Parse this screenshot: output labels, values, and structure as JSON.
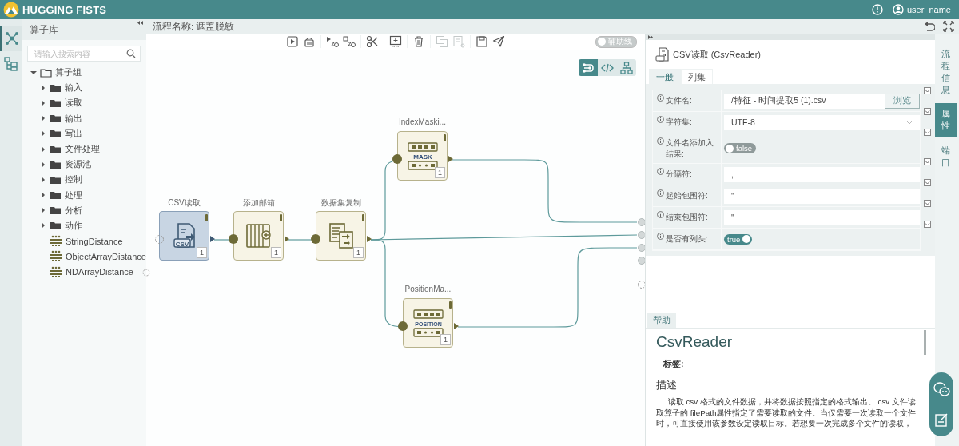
{
  "header": {
    "logo": "HUGGING FISTS",
    "user": "user_name"
  },
  "rail": [
    {
      "kind": "graph",
      "selected": true
    },
    {
      "kind": "tree",
      "selected": false
    }
  ],
  "sidebar": {
    "title": "算子库",
    "search": {
      "placeholder": "请输入搜索内容"
    },
    "tree": [
      {
        "label": "算子组",
        "kind": "folder",
        "expanded": true,
        "children": [
          {
            "label": "输入",
            "kind": "folder",
            "expanded": false
          },
          {
            "label": "读取",
            "kind": "folder",
            "expanded": false
          },
          {
            "label": "输出",
            "kind": "folder",
            "expanded": false
          },
          {
            "label": "写出",
            "kind": "folder",
            "expanded": false
          },
          {
            "label": "文件处理",
            "kind": "folder",
            "expanded": false
          },
          {
            "label": "资源池",
            "kind": "folder",
            "expanded": false
          },
          {
            "label": "控制",
            "kind": "folder",
            "expanded": false
          },
          {
            "label": "处理",
            "kind": "folder",
            "expanded": false
          },
          {
            "label": "分析",
            "kind": "folder",
            "expanded": false
          },
          {
            "label": "动作",
            "kind": "folder",
            "expanded": false
          },
          {
            "label": "StringDistance",
            "kind": "operator"
          },
          {
            "label": "ObjectArrayDistance",
            "kind": "operator"
          },
          {
            "label": "NDArrayDistance",
            "kind": "operator"
          }
        ]
      }
    ]
  },
  "flow": {
    "name": "流程名称: 遮盖脱敏",
    "toolbar_groups": [
      {
        "items": [
          {
            "kind": "run",
            "disabled": false
          },
          {
            "kind": "clear",
            "disabled": false
          }
        ]
      },
      {
        "items": [
          {
            "kind": "run-from",
            "disabled": false
          },
          {
            "kind": "run-to",
            "disabled": false
          }
        ]
      },
      {
        "items": [
          {
            "kind": "cut",
            "disabled": false
          }
        ]
      },
      {
        "items": [
          {
            "kind": "monitor",
            "disabled": false
          }
        ]
      },
      {
        "items": [
          {
            "kind": "delete",
            "disabled": false
          }
        ]
      },
      {
        "items": [
          {
            "kind": "copy",
            "disabled": true
          },
          {
            "kind": "paste",
            "disabled": true
          }
        ]
      },
      {
        "items": [
          {
            "kind": "save",
            "disabled": false
          },
          {
            "kind": "send",
            "disabled": false
          }
        ]
      }
    ],
    "guide_toggle": {
      "label": "辅助线",
      "on": false
    },
    "views": [
      {
        "kind": "flow",
        "selected": true
      },
      {
        "kind": "code",
        "selected": false
      },
      {
        "kind": "hierarchy",
        "selected": false
      }
    ],
    "nodes": [
      {
        "label": "CSV读取",
        "kind": "csv",
        "icon_text": "CSV",
        "count": "1",
        "selected": true
      },
      {
        "label": "添加邮箱",
        "kind": "add-column",
        "count": "1",
        "selected": false
      },
      {
        "label": "数据集复制",
        "kind": "copy",
        "count": "1",
        "selected": false
      },
      {
        "label": "IndexMaski...",
        "kind": "mask",
        "icon_text": "MASK",
        "count": "1",
        "selected": false
      },
      {
        "label": "PositionMa...",
        "kind": "mask",
        "icon_text": "POSITION",
        "count": "1",
        "selected": false
      }
    ],
    "outputs": [
      {
        "kind": "port"
      },
      {
        "kind": "port"
      },
      {
        "kind": "port"
      },
      {
        "kind": "port"
      },
      {
        "kind": "empty"
      }
    ]
  },
  "properties": {
    "title": "CSV读取 (CsvReader)",
    "tabs": [
      {
        "label": "一般",
        "selected": true
      },
      {
        "label": "列集",
        "selected": false
      }
    ],
    "fields": [
      {
        "label": "文件名:",
        "kind": "file",
        "value": "/特征 - 时间提取5 (1).csv",
        "button": "浏览"
      },
      {
        "label": "字符集:",
        "kind": "select",
        "value": "UTF-8"
      },
      {
        "label": "文件名添加入结果:",
        "kind": "switch",
        "on": false,
        "text": "false"
      },
      {
        "label": "分隔符:",
        "kind": "text",
        "value": ","
      },
      {
        "label": "起始包围符:",
        "kind": "text",
        "value": "\""
      },
      {
        "label": "结束包围符:",
        "kind": "text",
        "value": "\""
      },
      {
        "label": "是否有列头:",
        "kind": "switch",
        "on": true,
        "text": "true"
      }
    ]
  },
  "side_tabs": [
    {
      "label": "流程信息",
      "selected": false
    },
    {
      "label": "属性",
      "selected": true
    },
    {
      "label": "端口",
      "selected": false
    }
  ],
  "help": {
    "tab": "帮助",
    "title": "CsvReader",
    "tags_label": "标签:",
    "section": "描述",
    "text": "读取 csv 格式的文件数据，并将数据按照指定的格式输出。 csv 文件读取算子的 filePath属性指定了需要读取的文件。当仅需要一次读取一个文件时，可直接使用该参数设定读取目标。若想要一次完成多个文件的读取，"
  }
}
